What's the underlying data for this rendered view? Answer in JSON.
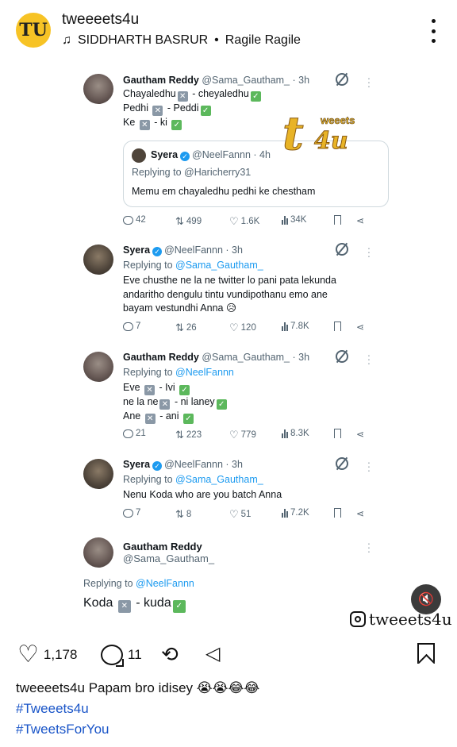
{
  "header": {
    "avatar_letter": "TU",
    "username": "tweeeets4u",
    "music_icon": "music-note-icon",
    "music_artist": "SIDDHARTH BASRUR",
    "music_separator": "•",
    "music_title": "Ragile Ragile"
  },
  "tweets": [
    {
      "name": "Gautham Reddy",
      "handle": "@Sama_Gautham_",
      "time": "· 3h",
      "lines": [
        {
          "before": "Chayaledhu",
          "after": " - cheyaledhu"
        },
        {
          "before": "Pedhi ",
          "after": " - Peddi"
        },
        {
          "before": "Ke ",
          "after": " - ki "
        }
      ],
      "quote": {
        "name": "Syera",
        "handle": "@NeelFannn",
        "time": "· 4h",
        "reply_prefix": "Replying to ",
        "reply_to": "@Haricherry31",
        "body": "Memu em chayaledhu pedhi ke chestham"
      },
      "stats": {
        "replies": "42",
        "reposts": "499",
        "likes": "1.6K",
        "views": "34K"
      }
    },
    {
      "name": "Syera",
      "handle": "@NeelFannn",
      "time": "· 3h",
      "reply_prefix": "Replying to ",
      "reply_to": "@Sama_Gautham_",
      "body": [
        "Eve chusthe ne la ne twitter lo pani pata lekunda",
        "andaritho dengulu tintu vundipothanu emo ane",
        "bayam vestundhi Anna 😥"
      ],
      "stats": {
        "replies": "7",
        "reposts": "26",
        "likes": "120",
        "views": "7.8K"
      }
    },
    {
      "name": "Gautham Reddy",
      "handle": "@Sama_Gautham_",
      "time": "· 3h",
      "reply_prefix": "Replying to ",
      "reply_to": "@NeelFannn",
      "lines": [
        {
          "before": "Eve ",
          "after": " - Ivi "
        },
        {
          "before": "ne la ne",
          "after": " - ni laney"
        },
        {
          "before": "Ane ",
          "after": " - ani "
        }
      ],
      "stats": {
        "replies": "21",
        "reposts": "223",
        "likes": "779",
        "views": "8.3K"
      }
    },
    {
      "name": "Syera",
      "handle": "@NeelFannn",
      "time": "· 3h",
      "reply_prefix": "Replying to ",
      "reply_to": "@Sama_Gautham_",
      "body": [
        "Nenu Koda who are you batch Anna"
      ],
      "stats": {
        "replies": "7",
        "reposts": "8",
        "likes": "51",
        "views": "7.2K"
      }
    },
    {
      "name": "Gautham Reddy",
      "handle": "@Sama_Gautham_",
      "reply_prefix": "Replying to ",
      "reply_to": "@NeelFannn",
      "line": {
        "before": "Koda ",
        "after": " - kuda"
      }
    }
  ],
  "watermark": {
    "word": "weeets",
    "letter": "t",
    "suffix": "4u"
  },
  "ig_handle": "tweeets4u",
  "actions": {
    "likes": "1,178",
    "comments": "11"
  },
  "caption": {
    "username": "tweeeets4u",
    "text": "Papam bro idisey 😭😭😂😂"
  },
  "hashtags": [
    "#Tweeets4u",
    "#TweetsForYou"
  ]
}
